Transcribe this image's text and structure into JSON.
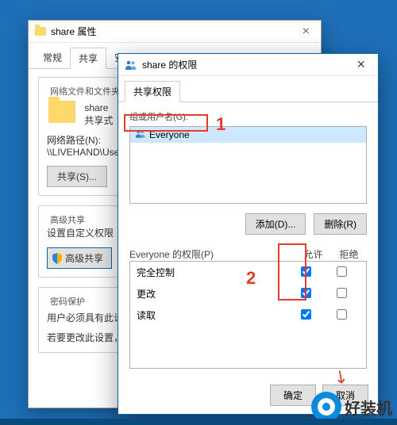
{
  "back_window": {
    "title": "share 属性",
    "tabs": [
      "常规",
      "共享",
      "安全"
    ],
    "active_tab_index": 1,
    "group_net_title": "网络文件和文件夹共享",
    "share_name": "share",
    "share_status": "共享式",
    "net_path_label": "网络路径(N):",
    "net_path_value": "\\\\LIVEHAND\\Use",
    "share_btn": "共享(S)...",
    "group_adv_title": "高级共享",
    "adv_desc": "设置自定义权限",
    "adv_btn": "高级共享",
    "group_pw_title": "密码保护",
    "pw_line1": "用户必须具有此计",
    "pw_line2": "若要更改此设置，"
  },
  "front_window": {
    "title": "share 的权限",
    "tab": "共享权限",
    "users_label": "组或用户名(G):",
    "users": [
      {
        "name": "Everyone",
        "selected": true
      }
    ],
    "add_btn": "添加(D)...",
    "remove_btn": "删除(R)",
    "perm_label": "Everyone 的权限(P)",
    "col_allow": "允许",
    "col_deny": "拒绝",
    "permissions": [
      {
        "name": "完全控制",
        "allow": true,
        "deny": false
      },
      {
        "name": "更改",
        "allow": true,
        "deny": false
      },
      {
        "name": "读取",
        "allow": true,
        "deny": false
      }
    ],
    "ok_btn": "确定",
    "cancel_btn": "取消"
  },
  "annotations": {
    "one": "1",
    "two": "2"
  },
  "watermark": "好装机"
}
